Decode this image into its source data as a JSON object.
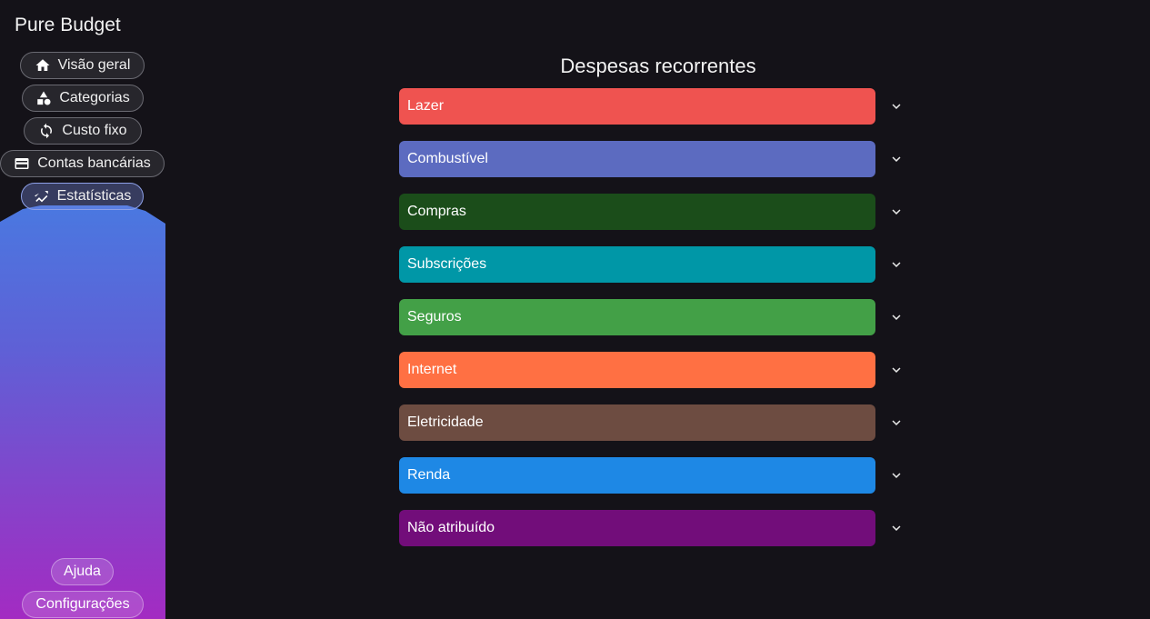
{
  "app": {
    "title": "Pure Budget"
  },
  "nav": {
    "items": [
      {
        "label": "Visão geral",
        "icon": "home-icon"
      },
      {
        "label": "Categorias",
        "icon": "shapes-icon"
      },
      {
        "label": "Custo fixo",
        "icon": "sync-icon"
      },
      {
        "label": "Contas bancárias",
        "icon": "wallet-icon"
      },
      {
        "label": "Estatísticas",
        "icon": "trend-icon",
        "active": true
      }
    ],
    "footer": {
      "help": "Ajuda",
      "settings": "Configurações"
    }
  },
  "main": {
    "title": "Despesas recorrentes",
    "categories": [
      {
        "label": "Lazer",
        "color": "#ef5350"
      },
      {
        "label": "Combustível",
        "color": "#5c6bc0"
      },
      {
        "label": "Compras",
        "color": "#1b4d1a"
      },
      {
        "label": "Subscrições",
        "color": "#0097a7"
      },
      {
        "label": "Seguros",
        "color": "#43a047"
      },
      {
        "label": "Internet",
        "color": "#ff7043"
      },
      {
        "label": "Eletricidade",
        "color": "#6d4c41"
      },
      {
        "label": "Renda",
        "color": "#1e88e5"
      },
      {
        "label": "Não atribuído",
        "color": "#720d7a"
      }
    ]
  }
}
